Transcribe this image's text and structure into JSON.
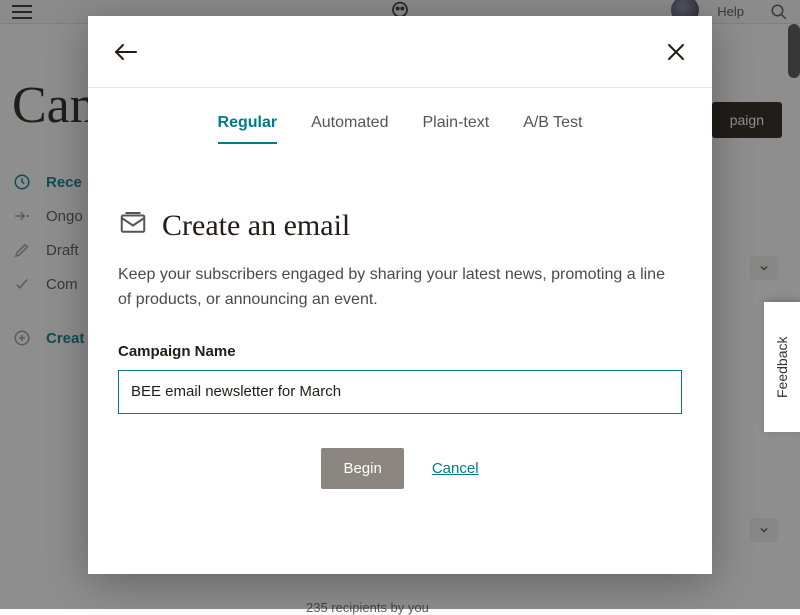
{
  "topbar": {
    "help_label": "Help"
  },
  "page": {
    "title_truncated": "Cam",
    "create_campaign_btn_visible": "paign",
    "recipients_line": "235 recipients by you"
  },
  "sidelist": {
    "recent": "Rece",
    "ongoing": "Ongo",
    "draft": "Draft",
    "completed": "Com",
    "create": "Creat"
  },
  "modal": {
    "tabs": {
      "regular": "Regular",
      "automated": "Automated",
      "plaintext": "Plain-text",
      "abtest": "A/B Test"
    },
    "heading": "Create an email",
    "description": "Keep your subscribers engaged by sharing your latest news, promoting a line of products, or announcing an event.",
    "field_label": "Campaign Name",
    "field_value": "BEE email newsletter for March",
    "begin_label": "Begin",
    "cancel_label": "Cancel"
  },
  "feedback_label": "Feedback"
}
